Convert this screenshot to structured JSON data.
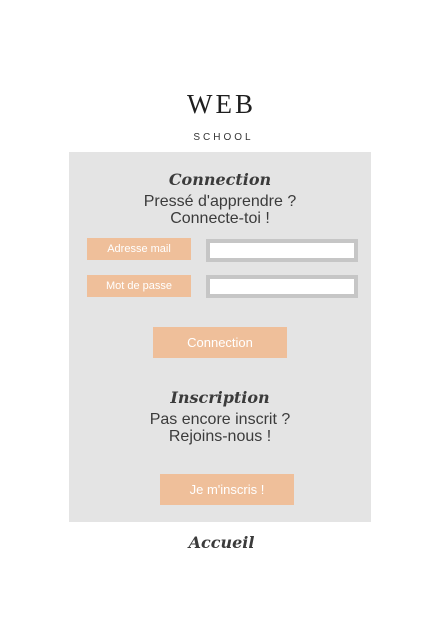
{
  "logo": {
    "title": "WEB",
    "subtitle": "SCHOOL"
  },
  "login": {
    "title": "Connection",
    "line1": "Pressé d'apprendre ?",
    "line2": "Connecte-toi !",
    "email_label": "Adresse mail",
    "email_value": "",
    "password_label": "Mot de passe",
    "password_value": "",
    "submit_label": "Connection"
  },
  "signup": {
    "title": "Inscription",
    "line1": "Pas encore inscrit ?",
    "line2": "Rejoins-nous !",
    "button_label": "Je m'inscris !"
  },
  "footer": {
    "home_link": "Accueil"
  },
  "colors": {
    "accent": "#efbf9a",
    "panel_bg": "#e4e4e4",
    "input_border": "#c6c6c6",
    "text": "#3b3b3b"
  }
}
